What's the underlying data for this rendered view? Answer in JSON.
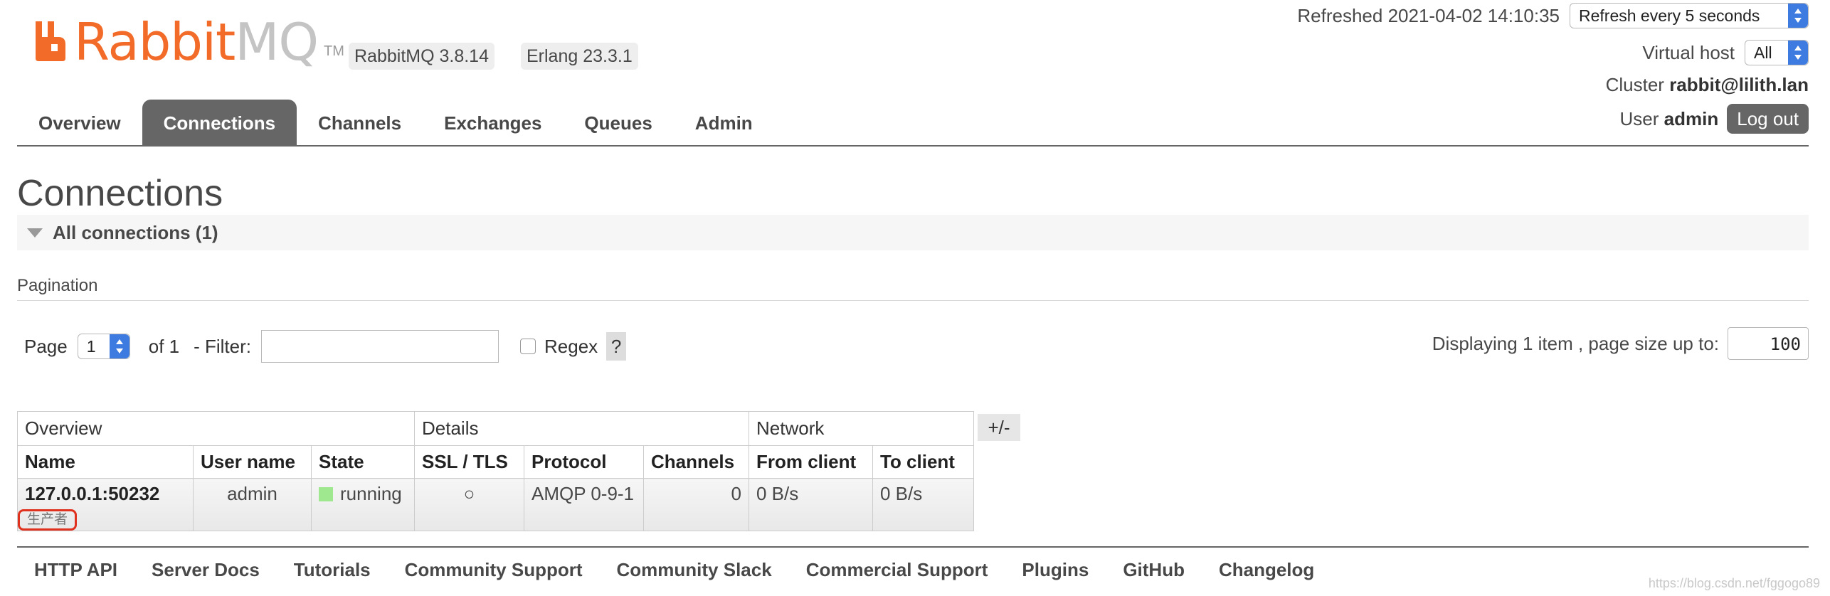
{
  "brand": {
    "name_part1": "Rabbit",
    "name_part2": "MQ",
    "tm": "TM",
    "logo_color": "#f26b28"
  },
  "versions": {
    "rabbitmq": "RabbitMQ 3.8.14",
    "erlang": "Erlang 23.3.1"
  },
  "status": {
    "refreshed_label": "Refreshed 2021-04-02 14:10:35",
    "refresh_option": "Refresh every 5 seconds",
    "vhost_label": "Virtual host",
    "vhost_value": "All",
    "cluster_label": "Cluster",
    "cluster_value": "rabbit@lilith.lan",
    "user_label": "User",
    "user_value": "admin",
    "logout_label": "Log out"
  },
  "tabs": [
    {
      "label": "Overview",
      "active": false
    },
    {
      "label": "Connections",
      "active": true
    },
    {
      "label": "Channels",
      "active": false
    },
    {
      "label": "Exchanges",
      "active": false
    },
    {
      "label": "Queues",
      "active": false
    },
    {
      "label": "Admin",
      "active": false
    }
  ],
  "page_title": "Connections",
  "section": {
    "title": "All connections (1)"
  },
  "pagination": {
    "label": "Pagination",
    "page_label": "Page",
    "page_value": "1",
    "of_label": "of 1",
    "filter_label": "- Filter:",
    "filter_value": "",
    "regex_label": "Regex",
    "help_label": "?",
    "display_label": "Displaying 1 item , page size up to:",
    "page_size": "100"
  },
  "table": {
    "groups": [
      "Overview",
      "Details",
      "Network"
    ],
    "columns": [
      "Name",
      "User name",
      "State",
      "SSL / TLS",
      "Protocol",
      "Channels",
      "From client",
      "To client"
    ],
    "rows": [
      {
        "name": "127.0.0.1:50232",
        "tag": "生产者",
        "user": "admin",
        "state": "running",
        "ssl": "○",
        "protocol": "AMQP 0-9-1",
        "channels": "0",
        "from_client": "0 B/s",
        "to_client": "0 B/s"
      }
    ],
    "toggle_label": "+/-"
  },
  "footer": [
    "HTTP API",
    "Server Docs",
    "Tutorials",
    "Community Support",
    "Community Slack",
    "Commercial Support",
    "Plugins",
    "GitHub",
    "Changelog"
  ],
  "watermark": "https://blog.csdn.net/fggogo89"
}
